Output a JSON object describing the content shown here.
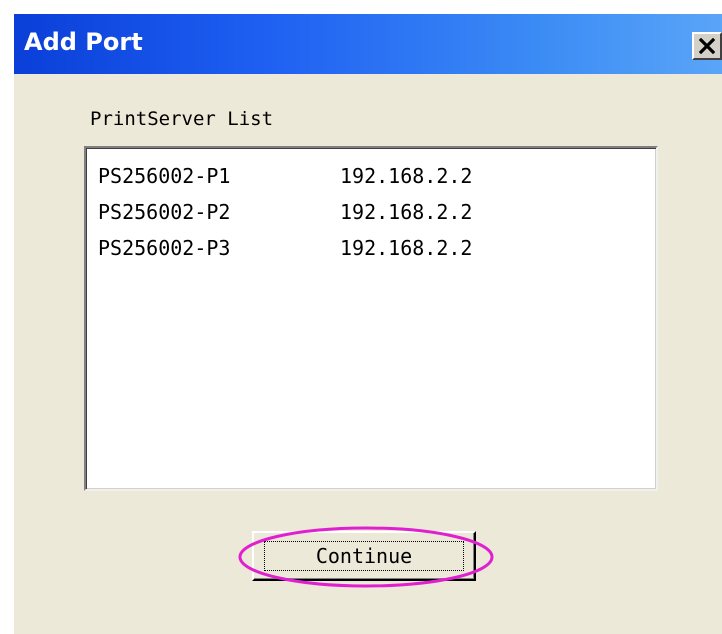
{
  "window": {
    "title": "Add Port",
    "close_glyph": "×"
  },
  "dialog": {
    "list_label": "PrintServer List",
    "items": [
      {
        "name": "PS256002-P1",
        "ip": "192.168.2.2"
      },
      {
        "name": "PS256002-P2",
        "ip": "192.168.2.2"
      },
      {
        "name": "PS256002-P3",
        "ip": "192.168.2.2"
      }
    ],
    "continue_label": "Continue"
  },
  "colors": {
    "titlebar": "#1e5ff2",
    "dialog_bg": "#ece9d8",
    "highlight": "#e020d0"
  },
  "icons": {
    "close": "close-icon"
  }
}
